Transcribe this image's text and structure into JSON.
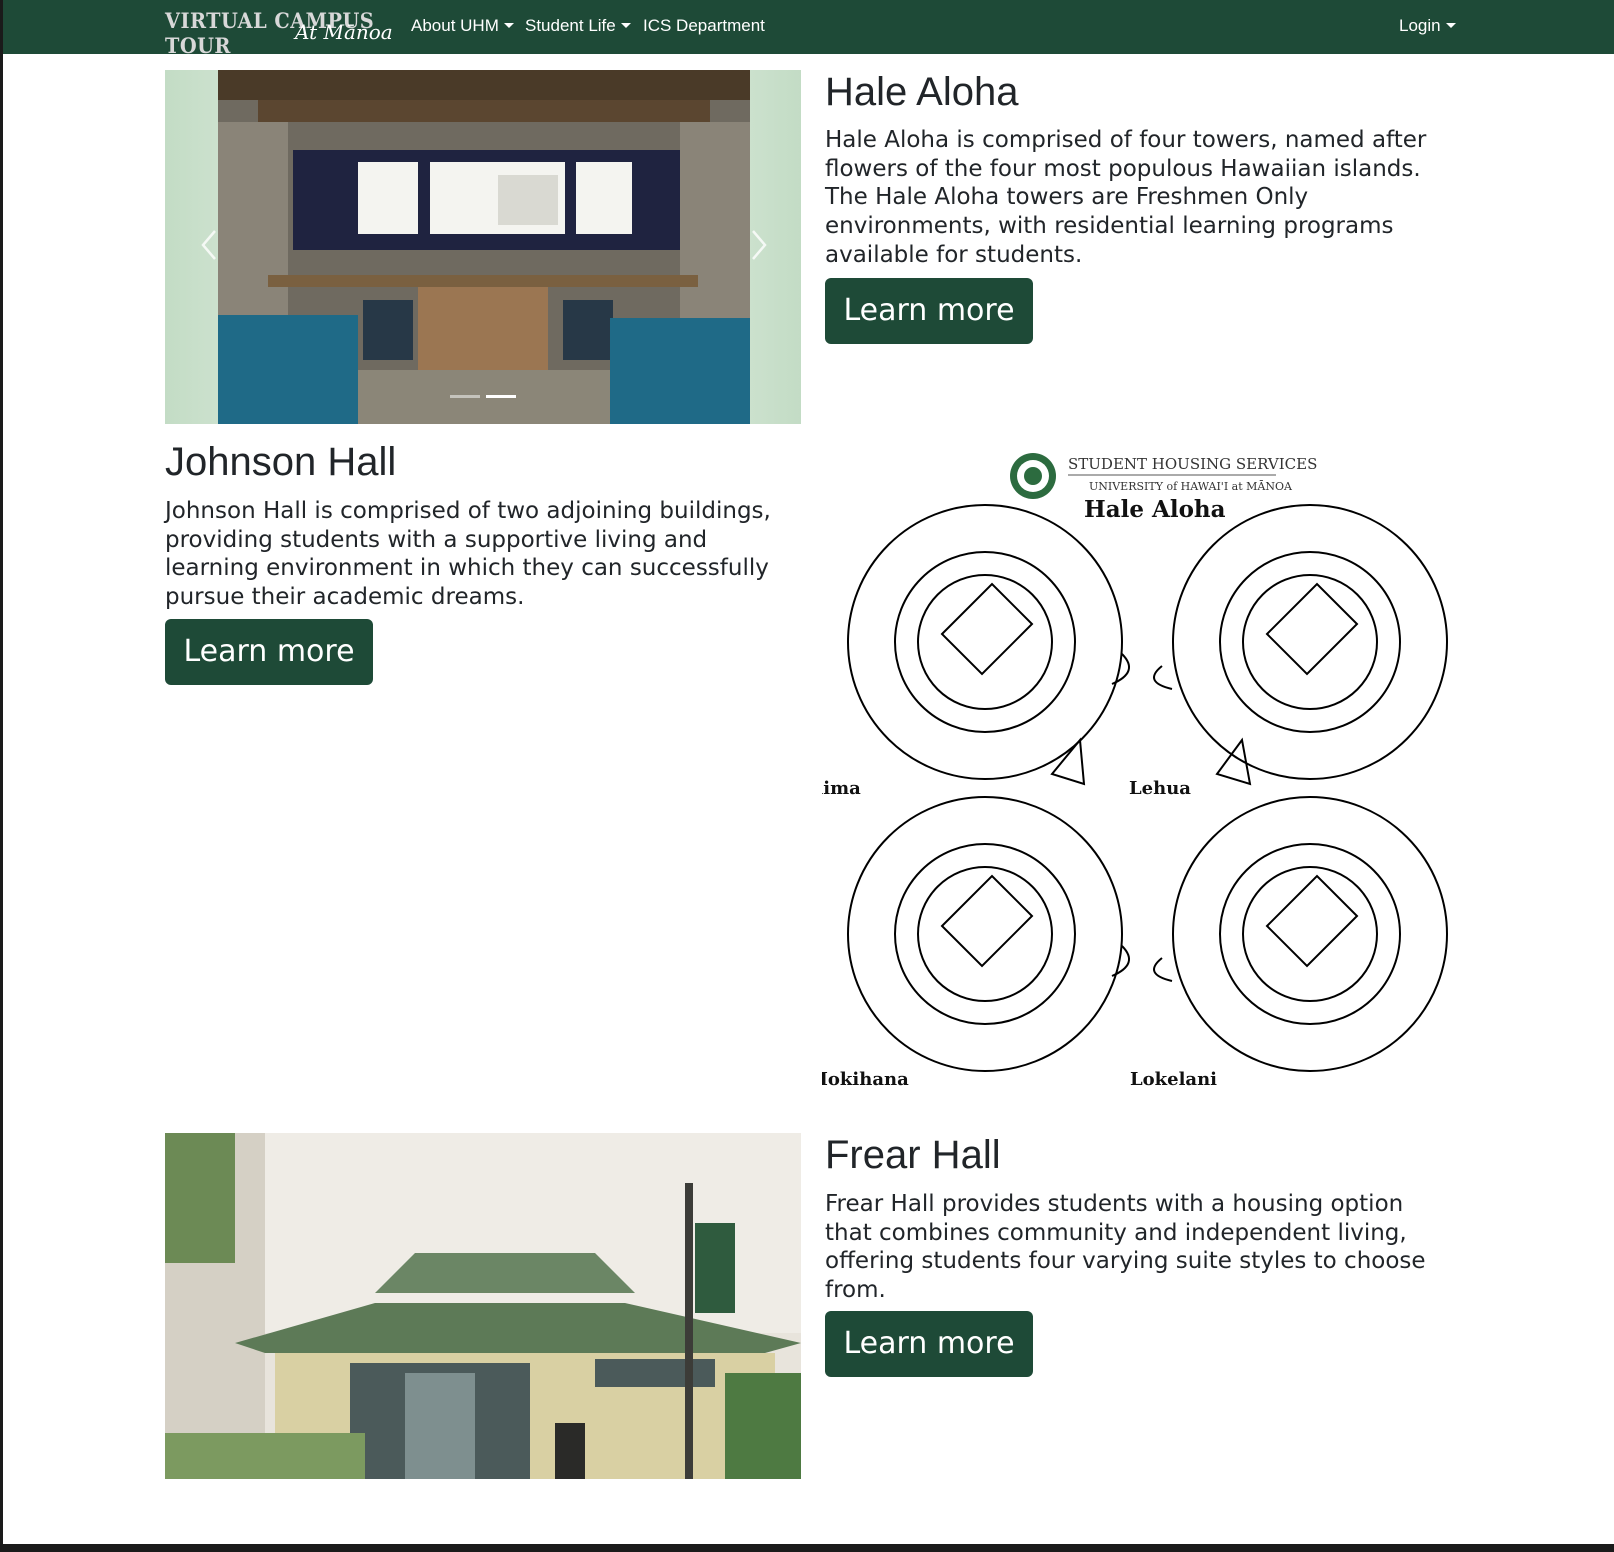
{
  "nav": {
    "brand_main": "VIRTUAL CAMPUS TOUR",
    "brand_sub": "At Mānoa",
    "items": [
      {
        "label": "About UHM",
        "dropdown": true
      },
      {
        "label": "Student Life",
        "dropdown": true
      },
      {
        "label": "ICS Department",
        "dropdown": false
      }
    ],
    "login": "Login"
  },
  "sections": [
    {
      "title": "Hale Aloha",
      "description": "Hale Aloha is comprised of four towers, named after flowers of the four most populous Hawaiian islands. The Hale Aloha towers are Freshmen Only environments, with residential learning programs available for students.",
      "button": "Learn more"
    },
    {
      "title": "Johnson Hall",
      "description": "Johnson Hall is comprised of two adjoining buildings, providing students with a supportive living and learning environment in which they can successfully pursue their academic dreams.",
      "button": "Learn more"
    },
    {
      "title": "Frear Hall",
      "description": "Frear Hall provides students with a housing option that combines community and independent living, offering students four varying suite styles to choose from.",
      "button": "Learn more"
    }
  ],
  "carousel": {
    "slide_count": 2,
    "active_index": 1,
    "prev_icon": "chevron-left-icon",
    "next_icon": "chevron-right-icon"
  },
  "floorplan": {
    "org": "STUDENT HOUSING SERVICES",
    "university": "UNIVERSITY of HAWAI'I at MĀNOA",
    "title": "Hale Aloha",
    "towers": [
      "Ilima",
      "Lehua",
      "Mokihana",
      "Lokelani"
    ]
  },
  "colors": {
    "brand_green": "#1e4a37",
    "text": "#212529"
  }
}
